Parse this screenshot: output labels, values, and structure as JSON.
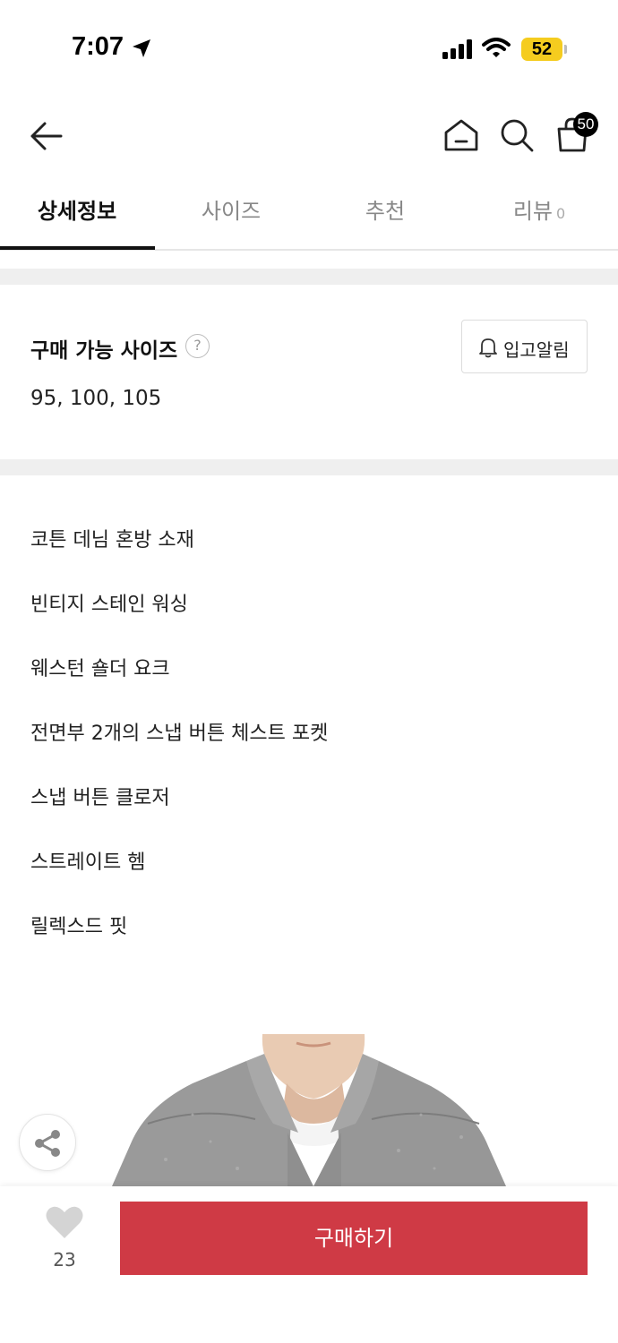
{
  "status": {
    "time": "7:07",
    "battery": "52"
  },
  "nav": {
    "cart_count": "50"
  },
  "tabs": [
    {
      "label": "상세정보"
    },
    {
      "label": "사이즈"
    },
    {
      "label": "추천"
    },
    {
      "label": "리뷰",
      "count": "0"
    }
  ],
  "sizes": {
    "title": "구매 가능 사이즈",
    "help": "?",
    "values": "95, 100, 105",
    "restock_label": "입고알림"
  },
  "features": [
    "코튼 데님 혼방 소재",
    "빈티지 스테인 워싱",
    "웨스턴 숄더 요크",
    "전면부 2개의 스냅 버튼 체스트 포켓",
    "스냅 버튼 클로저",
    "스트레이트 헴",
    "릴렉스드 핏"
  ],
  "bottom": {
    "like_count": "23",
    "buy_label": "구매하기"
  },
  "colors": {
    "buy": "#cf3a45",
    "battery": "#f5cc1f"
  }
}
